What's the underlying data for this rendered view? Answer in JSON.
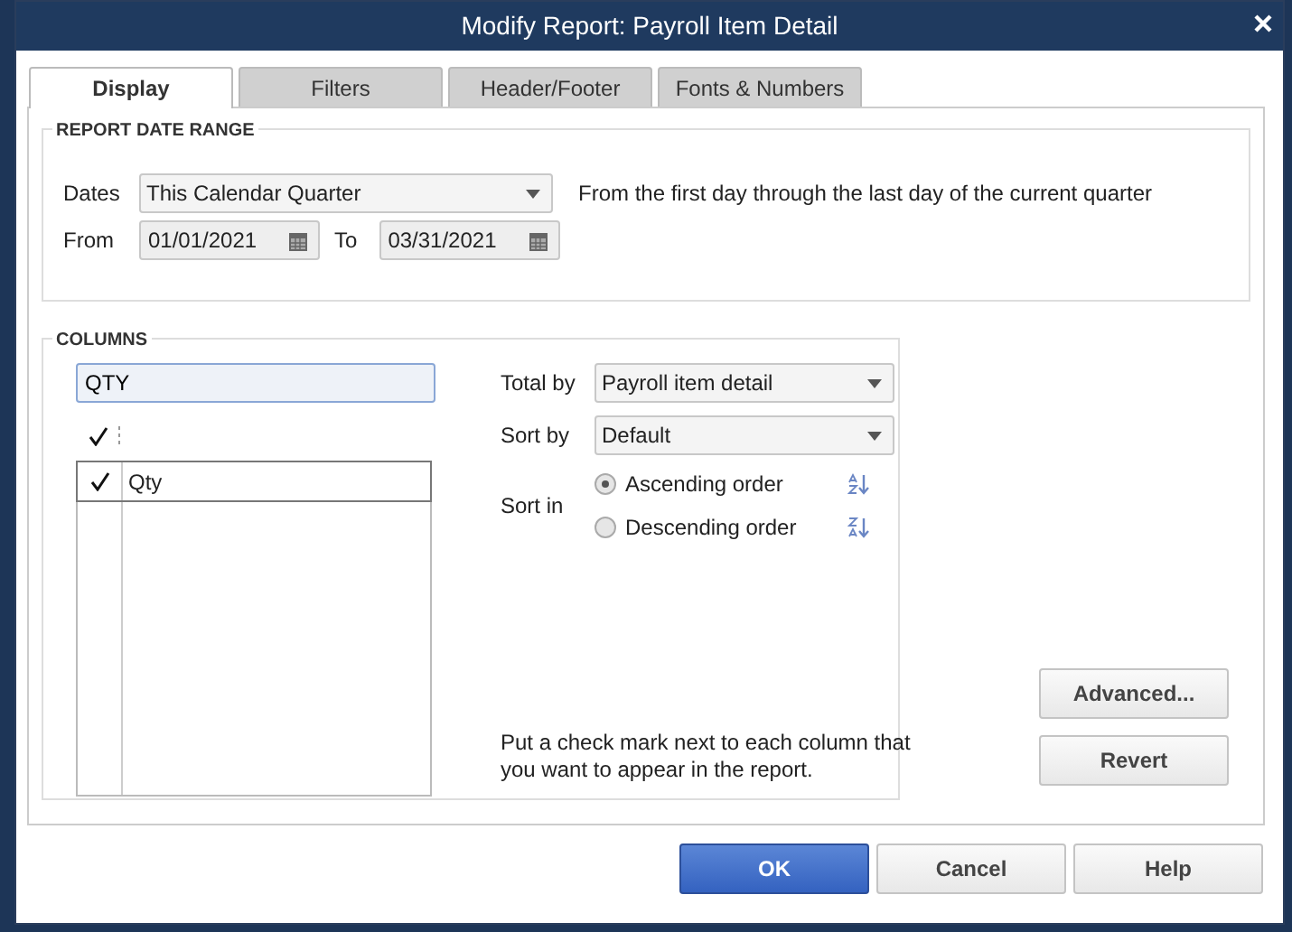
{
  "window": {
    "title": "Modify Report: Payroll Item Detail"
  },
  "tabs": [
    {
      "label": "Display",
      "selected": true
    },
    {
      "label": "Filters",
      "selected": false
    },
    {
      "label": "Header/Footer",
      "selected": false
    },
    {
      "label": "Fonts & Numbers",
      "selected": false
    }
  ],
  "date_range": {
    "heading": "REPORT DATE RANGE",
    "dates_label": "Dates",
    "dates_value": "This Calendar Quarter",
    "description": "From the first day through the last day of the current quarter",
    "from_label": "From",
    "from_value": "01/01/2021",
    "to_label": "To",
    "to_value": "03/31/2021"
  },
  "columns": {
    "heading": "COLUMNS",
    "search_value": "QTY",
    "items": [
      {
        "label": "Qty",
        "checked": true,
        "selected": true
      }
    ],
    "total_by_label": "Total by",
    "total_by_value": "Payroll item detail",
    "sort_by_label": "Sort by",
    "sort_by_value": "Default",
    "sort_in_label": "Sort in",
    "sort_options": [
      {
        "label": "Ascending order",
        "selected": true
      },
      {
        "label": "Descending order",
        "selected": false
      }
    ],
    "hint": "Put a check mark next to each column that you want to appear in the report."
  },
  "side_buttons": [
    "Advanced...",
    "Revert"
  ],
  "buttons": [
    {
      "label": "OK",
      "kind": "primary"
    },
    {
      "label": "Cancel",
      "kind": "normal"
    },
    {
      "label": "Help",
      "kind": "normal"
    }
  ]
}
